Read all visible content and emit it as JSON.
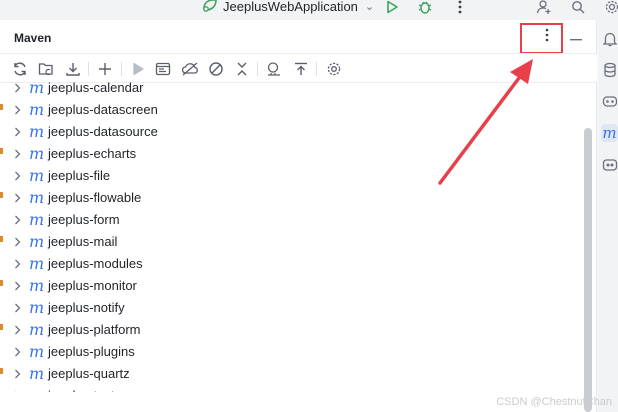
{
  "topbar": {
    "run_config": "JeeplusWebApplication",
    "run_icon": "run-icon",
    "debug_icon": "debug-icon",
    "more_icon": "more-vertical-icon",
    "add_user_icon": "add-user-icon",
    "search_icon": "search-icon",
    "settings_icon": "gear-icon"
  },
  "panel": {
    "title": "Maven",
    "more_icon": "more-vertical-icon",
    "minimize_icon": "minimize-icon"
  },
  "toolbar": {
    "icons": [
      "reload-icon",
      "add-project-icon",
      "download-icon",
      "plus-icon",
      "run-icon",
      "execute-goal-icon",
      "offline-icon",
      "skip-tests-icon",
      "collapse-icon",
      "analyze-icon",
      "show-dependencies-icon",
      "settings-icon"
    ]
  },
  "tree": {
    "items": [
      {
        "label": "jeeplus-calendar"
      },
      {
        "label": "jeeplus-datascreen"
      },
      {
        "label": "jeeplus-datasource"
      },
      {
        "label": "jeeplus-echarts"
      },
      {
        "label": "jeeplus-file"
      },
      {
        "label": "jeeplus-flowable"
      },
      {
        "label": "jeeplus-form"
      },
      {
        "label": "jeeplus-mail"
      },
      {
        "label": "jeeplus-modules"
      },
      {
        "label": "jeeplus-monitor"
      },
      {
        "label": "jeeplus-notify"
      },
      {
        "label": "jeeplus-platform"
      },
      {
        "label": "jeeplus-plugins"
      },
      {
        "label": "jeeplus-quartz"
      },
      {
        "label": "jeeplus-test"
      }
    ],
    "maven_icon_glyph": "m"
  },
  "rightbar": {
    "icons": [
      "notifications-icon",
      "database-icon",
      "copilot-icon",
      "maven-icon",
      "gradle-icon"
    ]
  },
  "colors": {
    "accent": "#3574f0",
    "highlight": "#e8404a",
    "run_green": "#3ea35b"
  },
  "watermark": "CSDN @ChestnutChan"
}
